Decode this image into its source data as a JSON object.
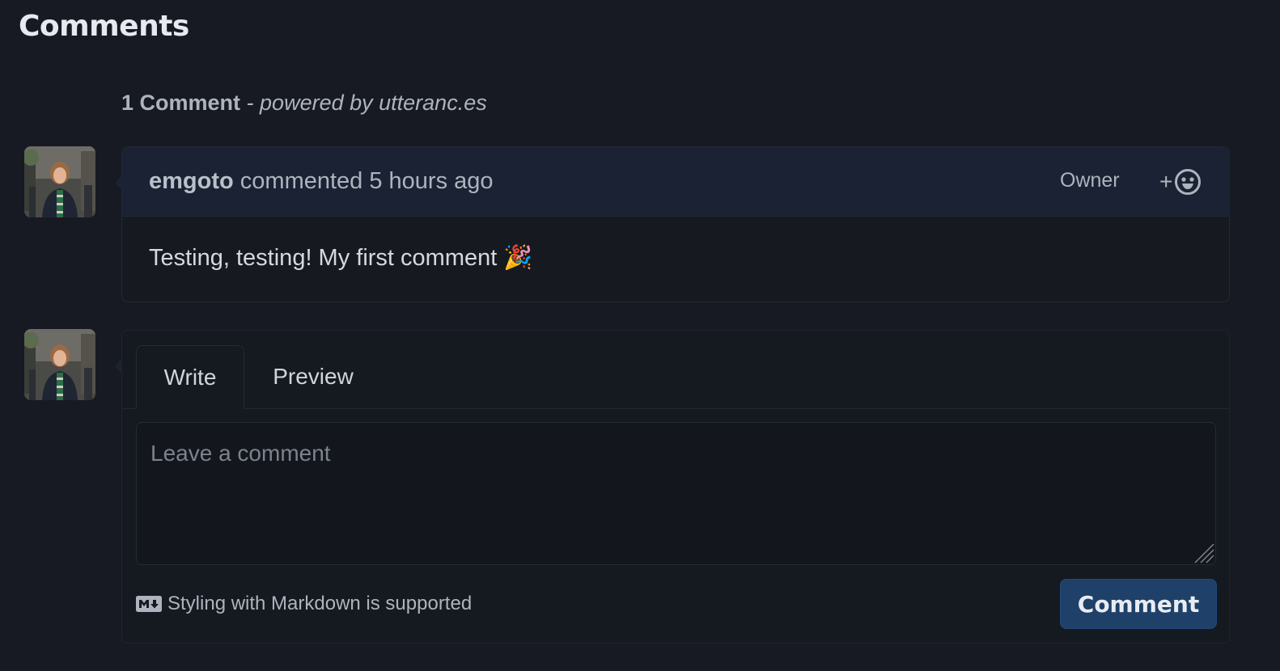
{
  "section": {
    "title": "Comments"
  },
  "thread": {
    "count_label": "1 Comment",
    "powered_by": "- powered by utteranc.es"
  },
  "comments": [
    {
      "author": "emgoto",
      "action": "commented",
      "time": "5 hours ago",
      "badge": "Owner",
      "reaction_icon": "smiley-icon",
      "body": "Testing, testing! My first comment",
      "body_emoji": "🎉"
    }
  ],
  "form": {
    "tabs": [
      "Write",
      "Preview"
    ],
    "active_tab": "Write",
    "textarea": {
      "value": "",
      "placeholder": "Leave a comment"
    },
    "markdown_note": "Styling with Markdown is supported",
    "submit_label": "Comment"
  },
  "colors": {
    "background": "#171a22",
    "header": "#1b2234",
    "button": "#1f4068"
  }
}
